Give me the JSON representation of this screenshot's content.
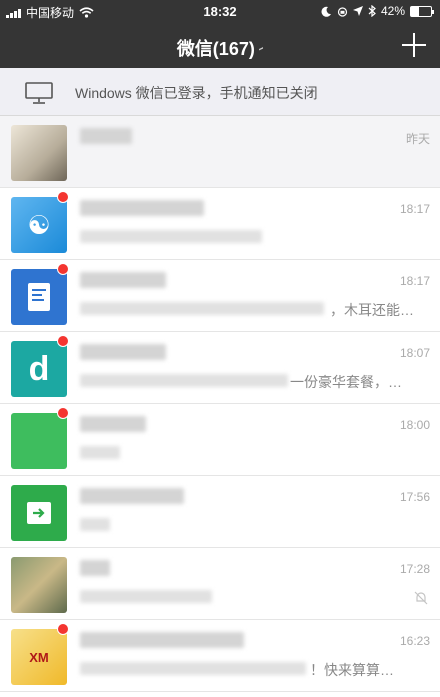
{
  "status_bar": {
    "carrier": "中国移动",
    "time": "18:32",
    "battery": "42%",
    "battery_level": 0.42
  },
  "header": {
    "title": "微信(167)",
    "plus_icon": "plus-icon",
    "mute_icon": "ear-icon"
  },
  "notice": {
    "icon": "desktop-monitor-icon",
    "text": "Windows 微信已登录，手机通知已关闭"
  },
  "chats": [
    {
      "time": "昨天",
      "preview": "",
      "pinned": true,
      "unread": false,
      "avatar": "photo-avatar",
      "muted": false
    },
    {
      "time": "18:17",
      "preview": "",
      "pinned": false,
      "unread": true,
      "avatar": "blue-app-avatar",
      "muted": false
    },
    {
      "time": "18:17",
      "preview": "，木耳还能…",
      "pinned": false,
      "unread": true,
      "avatar": "document-app-avatar",
      "muted": false
    },
    {
      "time": "18:07",
      "preview": "一份豪华套餐，…",
      "pinned": false,
      "unread": true,
      "avatar": "teal-d-avatar",
      "muted": false
    },
    {
      "time": "18:00",
      "preview": "",
      "pinned": false,
      "unread": true,
      "avatar": "green-avatar",
      "muted": false
    },
    {
      "time": "17:56",
      "preview": "",
      "pinned": false,
      "unread": false,
      "avatar": "green-arrow-avatar",
      "muted": false
    },
    {
      "time": "17:28",
      "preview": "",
      "pinned": false,
      "unread": false,
      "avatar": "photo-avatar",
      "muted": true
    },
    {
      "time": "16:23",
      "preview": "！快来算算…",
      "pinned": false,
      "unread": true,
      "avatar": "xm-logo-avatar",
      "muted": false
    }
  ],
  "colors": {
    "header_bg": "#353535",
    "badge_red": "#f43530",
    "notice_bg": "#efeff4"
  }
}
